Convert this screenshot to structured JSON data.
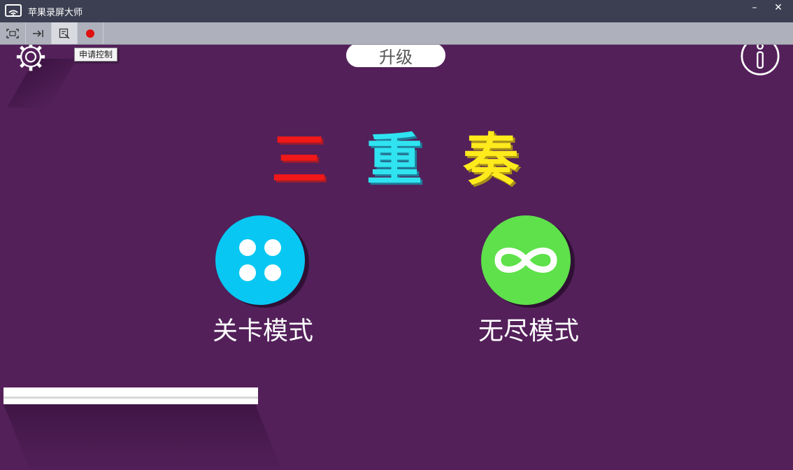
{
  "app": {
    "title": "苹果录屏大师",
    "window_controls": {
      "minimize": "–",
      "close": "✕"
    }
  },
  "toolbar": {
    "tools": [
      {
        "name": "screenshot-tool",
        "icon": "capture-frame-icon"
      },
      {
        "name": "pin-tool",
        "icon": "pin-arrow-icon"
      },
      {
        "name": "control-tool",
        "icon": "control-request-icon"
      },
      {
        "name": "record-tool",
        "icon": "record-dot-icon"
      }
    ],
    "tooltip": "申请控制"
  },
  "game": {
    "upgrade_label": "升级",
    "title_chars": [
      "三",
      "重",
      "奏"
    ],
    "modes": [
      {
        "label": "关卡模式",
        "icon": "four-dots-icon",
        "color": "#08c7f2"
      },
      {
        "label": "无尽模式",
        "icon": "infinity-icon",
        "color": "#5ee14a"
      }
    ],
    "progress": 1.0
  },
  "colors": {
    "background": "#53205a",
    "titlebar": "#3c3f51",
    "toolbar": "#aeb1bc",
    "record": "#e01010",
    "title_red": "#f01818",
    "title_cyan": "#2fe4f0",
    "title_yellow": "#ffea1c"
  }
}
